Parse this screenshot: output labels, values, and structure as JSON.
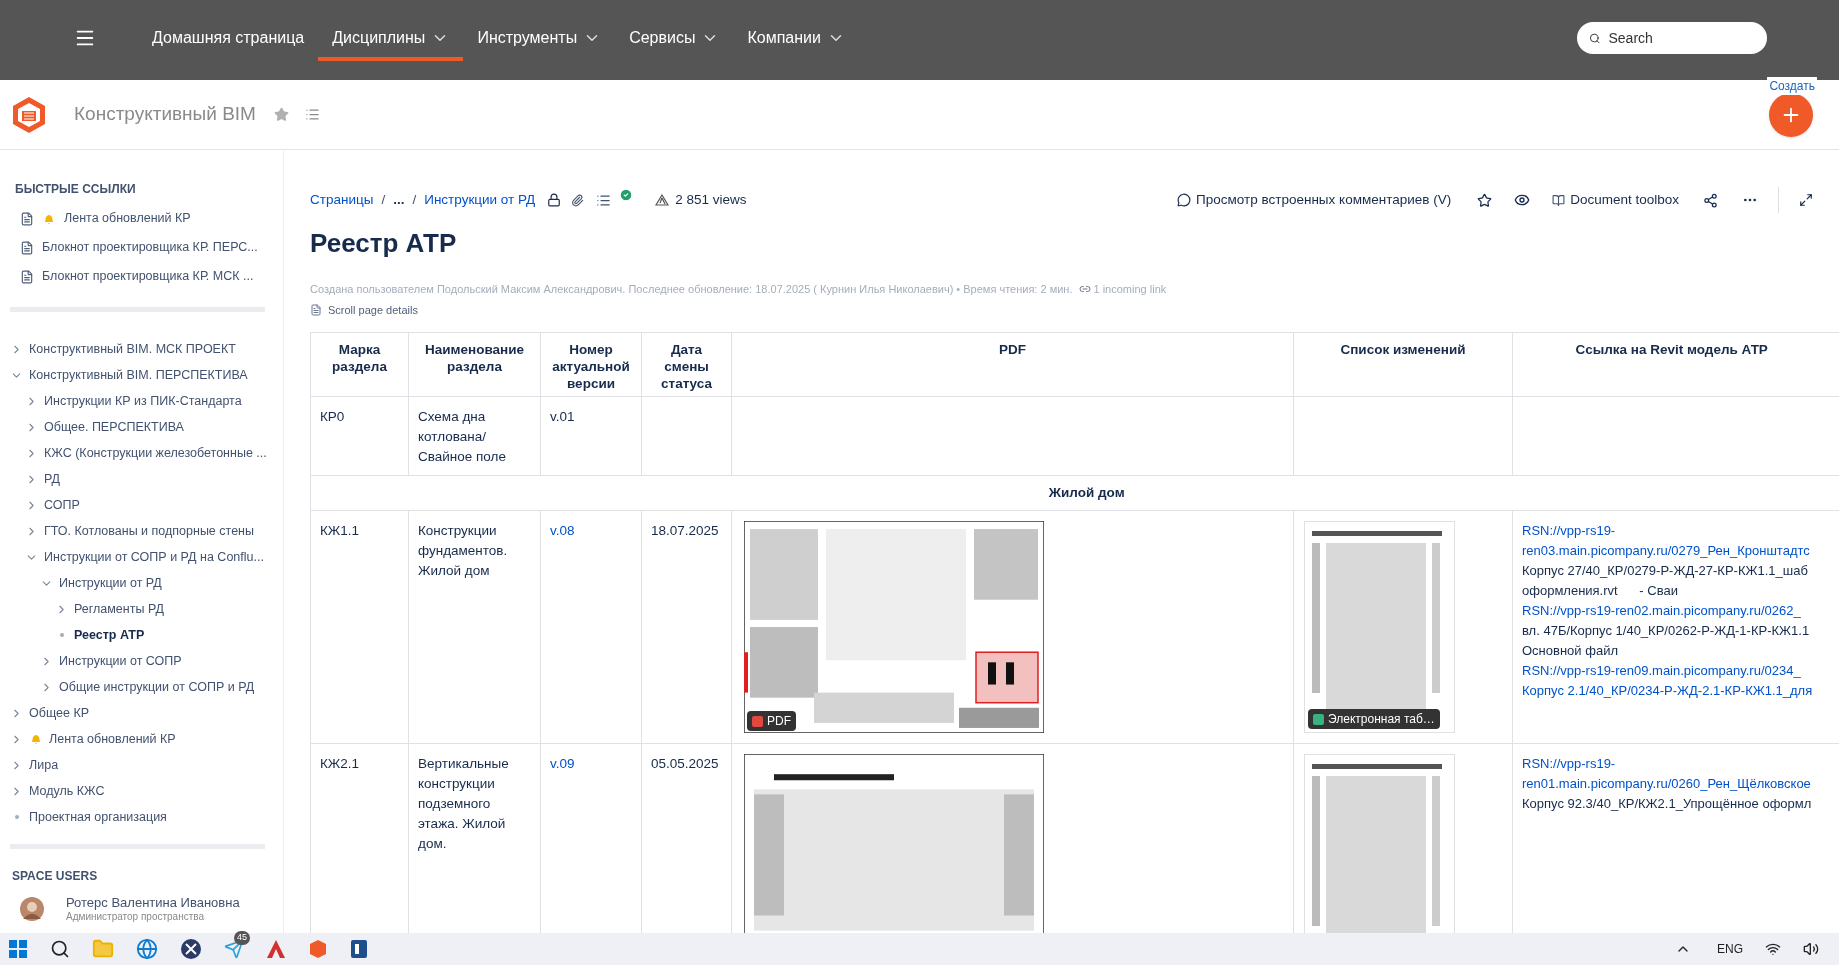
{
  "top_nav": {
    "items": [
      {
        "label": "Домашняя страница",
        "selected": false,
        "dropdown": false
      },
      {
        "label": "Дисциплины",
        "selected": true,
        "dropdown": true
      },
      {
        "label": "Инструменты",
        "selected": false,
        "dropdown": true
      },
      {
        "label": "Сервисы",
        "selected": false,
        "dropdown": true
      },
      {
        "label": "Компании",
        "selected": false,
        "dropdown": true
      }
    ],
    "search": {
      "placeholder": "Search"
    }
  },
  "space_header": {
    "title": "Конструктивный BIM",
    "create_button": "Создать"
  },
  "sidebar": {
    "quick_links_title": "БЫСТРЫЕ ССЫЛКИ",
    "quick_links": [
      {
        "label": "Лента обновлений КР",
        "has_bell": true
      },
      {
        "label": "Блокнот проектировщика КР. ПЕРС...",
        "has_bell": false
      },
      {
        "label": "Блокнот проектировщика КР. МСК ...",
        "has_bell": false
      }
    ],
    "tree": [
      {
        "label": "Конструктивный BIM. МСК ПРОЕКТ",
        "kind": "branch",
        "expanded": false,
        "selected": false,
        "has_bell": false
      },
      {
        "label": "Конструктивный BIM. ПЕРСПЕКТИВА",
        "kind": "branch",
        "expanded": true,
        "selected": false,
        "has_bell": false,
        "children": [
          {
            "label": "Инструкции КР из ПИК-Стандарта",
            "kind": "branch",
            "expanded": false,
            "selected": false,
            "has_bell": false
          },
          {
            "label": "Общее. ПЕРСПЕКТИВА",
            "kind": "branch",
            "expanded": false,
            "selected": false,
            "has_bell": false
          },
          {
            "label": "КЖС (Конструкции железобетонные ...",
            "kind": "branch",
            "expanded": false,
            "selected": false,
            "has_bell": false
          },
          {
            "label": "РД",
            "kind": "branch",
            "expanded": false,
            "selected": false,
            "has_bell": false
          },
          {
            "label": "СОПР",
            "kind": "branch",
            "expanded": false,
            "selected": false,
            "has_bell": false
          },
          {
            "label": "ГТО. Котлованы и подпорные стены",
            "kind": "branch",
            "expanded": false,
            "selected": false,
            "has_bell": false
          },
          {
            "label": "Инструкции от СОПР и РД на Conflu...",
            "kind": "branch",
            "expanded": true,
            "selected": false,
            "has_bell": false,
            "children": [
              {
                "label": "Инструкции от РД",
                "kind": "branch",
                "expanded": true,
                "selected": false,
                "has_bell": false,
                "children": [
                  {
                    "label": "Регламенты РД",
                    "kind": "branch",
                    "expanded": false,
                    "selected": false,
                    "has_bell": false
                  },
                  {
                    "label": "Реестр АТР",
                    "kind": "leaf",
                    "selected": true,
                    "has_bell": false
                  }
                ]
              },
              {
                "label": "Инструкции от СОПР",
                "kind": "branch",
                "expanded": false,
                "selected": false,
                "has_bell": false
              },
              {
                "label": "Общие инструкции от СОПР и РД",
                "kind": "branch",
                "expanded": false,
                "selected": false,
                "has_bell": false
              }
            ]
          }
        ]
      },
      {
        "label": "Общее КР",
        "kind": "branch",
        "expanded": false,
        "selected": false,
        "has_bell": false
      },
      {
        "label": "Лента обновлений КР",
        "kind": "branch",
        "expanded": false,
        "selected": false,
        "has_bell": true
      },
      {
        "label": "Лира",
        "kind": "branch",
        "expanded": false,
        "selected": false,
        "has_bell": false
      },
      {
        "label": "Модуль КЖС",
        "kind": "branch",
        "expanded": false,
        "selected": false,
        "has_bell": false
      },
      {
        "label": "Проектная организация",
        "kind": "leaf",
        "selected": false,
        "has_bell": false
      }
    ],
    "users_title": "SPACE USERS",
    "users": [
      {
        "name": "Ротерс Валентина Ивановна",
        "role": "Администратор пространства"
      }
    ]
  },
  "breadcrumbs": [
    {
      "label": "Страницы",
      "kind": "link"
    },
    {
      "label": "...",
      "kind": "ellipsis"
    },
    {
      "label": "Инструкции от РД",
      "kind": "link"
    }
  ],
  "breadcrumb_separator": "/",
  "views": "2 851 views",
  "page_actions": {
    "comments": "Просмотр встроенных комментариев (V)",
    "toolbox": "Document toolbox"
  },
  "page": {
    "title": "Реестр АТР",
    "meta": "Создана пользователем Подольский Максим Александрович. Последнее обновление: 18.07.2025 ( Курнин Илья Николаевич) • Время чтения: 2 мин.",
    "incoming": "1 incoming link",
    "scroll_details": "Scroll page details"
  },
  "table": {
    "columns": [
      "Марка раздела",
      "Наименование раздела",
      "Номер актуальной версии",
      "Дата смены статуса",
      "PDF",
      "Список изменений",
      "Ссылка на Revit модель АТР"
    ],
    "rows": [
      {
        "kind": "data",
        "mark": "КР0",
        "name": "Схема дна котлована/ Свайное поле",
        "version": "v.01",
        "version_link": false,
        "date": "",
        "pdf": null,
        "changes": null,
        "links": []
      },
      {
        "kind": "group",
        "label": "Жилой дом"
      },
      {
        "kind": "data",
        "mark": "КЖ1.1",
        "name": "Конструкции фундаментов. Жилой дом",
        "version": "v.08",
        "version_link": true,
        "date": "18.07.2025",
        "pdf": {
          "badge": "PDF"
        },
        "changes": {
          "badge": "Электронная таб…"
        },
        "links": [
          {
            "text": "RSN://vpp-rs19-",
            "link": true
          },
          {
            "text": "ren03.main.picompany.ru/0279_Рен_Кронштадтс",
            "link": true
          },
          {
            "text": "Корпус 27/40_КР/0279-Р-ЖД-27-КР-КЖ1.1_шаб",
            "link": false
          },
          {
            "text": "оформления.rvt      - Сваи",
            "link": false
          },
          {
            "text": "RSN://vpp-rs19-ren02.main.picompany.ru/0262_",
            "link": true
          },
          {
            "text": "вл. 47Б/Корпус 1/40_КР/0262-Р-ЖД-1-КР-КЖ1.1",
            "link": false
          },
          {
            "text": "Основной файл",
            "link": false
          },
          {
            "text": "RSN://vpp-rs19-ren09.main.picompany.ru/0234_",
            "link": true
          },
          {
            "text": "Корпус 2.1/40_КР/0234-Р-ЖД-2.1-КР-КЖ1.1_для",
            "link": true
          }
        ]
      },
      {
        "kind": "data",
        "mark": "КЖ2.1",
        "name": "Вертикальные конструкции подземного этажа. Жилой дом.",
        "version": "v.09",
        "version_link": true,
        "date": "05.05.2025",
        "pdf": {},
        "changes": {},
        "links": [
          {
            "text": "RSN://vpp-rs19-",
            "link": true
          },
          {
            "text": "ren01.main.picompany.ru/0260_Рен_Щёлковское",
            "link": true
          },
          {
            "text": "Корпус 92.3/40_КР/КЖ2.1_Упрощённое оформл",
            "link": false
          }
        ]
      }
    ]
  },
  "taskbar": {
    "badge": "45",
    "language": "ENG"
  }
}
